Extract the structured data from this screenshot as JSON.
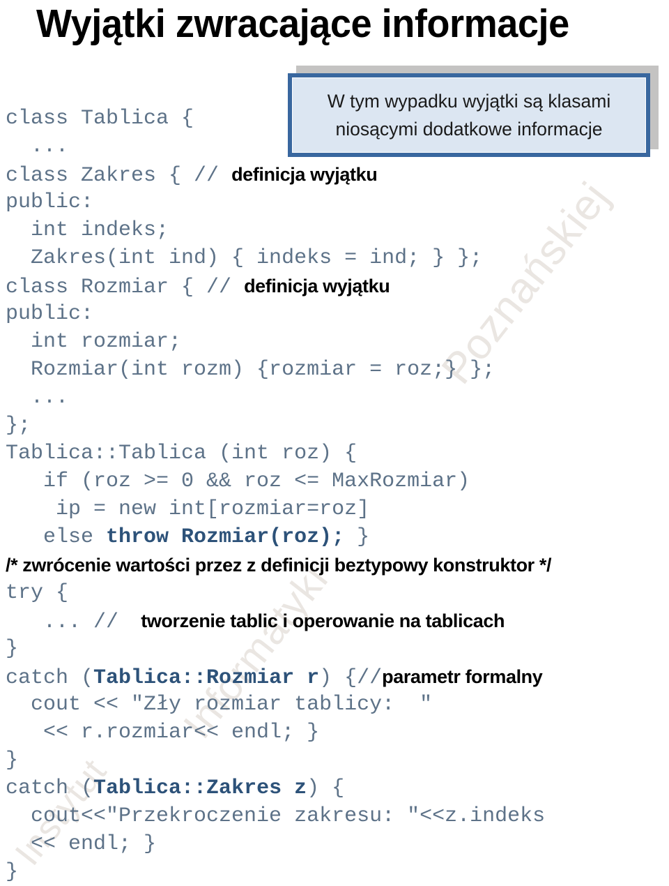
{
  "slide": {
    "title": "Wyjątki zwracające informacje",
    "background_color": "#ffffff"
  },
  "callout": {
    "lines": [
      "W tym wypadku wyjątki są klasami",
      "niosącymi dodatkowe informacje"
    ],
    "fill_color": "#dce6f2",
    "border_color": "#39679f",
    "shadow_color": "#c4c3c2"
  },
  "code": {
    "mono_color": "#5d7288",
    "mono_bold_color": "#2d5279",
    "comment_color": "#000000",
    "lines": [
      {
        "segments": [
          {
            "text": "class Tablica {",
            "style": "mono"
          }
        ]
      },
      {
        "segments": [
          {
            "text": "  ...",
            "style": "mono"
          }
        ]
      },
      {
        "segments": [
          {
            "text": "class Zakres { // ",
            "style": "mono"
          },
          {
            "text": "definicja wyjątku",
            "style": "comment"
          }
        ]
      },
      {
        "segments": [
          {
            "text": "public:",
            "style": "mono"
          }
        ]
      },
      {
        "segments": [
          {
            "text": "  int indeks;",
            "style": "mono"
          }
        ]
      },
      {
        "segments": [
          {
            "text": "  Zakres(int ind) { indeks = ind; } };",
            "style": "mono"
          }
        ]
      },
      {
        "segments": [
          {
            "text": "class Rozmiar { // ",
            "style": "mono"
          },
          {
            "text": "definicja wyjątku",
            "style": "comment"
          }
        ]
      },
      {
        "segments": [
          {
            "text": "public:",
            "style": "mono"
          }
        ]
      },
      {
        "segments": [
          {
            "text": "  int rozmiar;",
            "style": "mono"
          }
        ]
      },
      {
        "segments": [
          {
            "text": "  Rozmiar(int rozm) {rozmiar = roz;} };",
            "style": "mono"
          }
        ]
      },
      {
        "segments": [
          {
            "text": "  ...",
            "style": "mono"
          }
        ]
      },
      {
        "segments": [
          {
            "text": "};",
            "style": "mono"
          }
        ]
      },
      {
        "segments": [
          {
            "text": "Tablica::Tablica (int roz) {",
            "style": "mono"
          }
        ]
      },
      {
        "segments": [
          {
            "text": "   if (roz >= 0 && roz <= MaxRozmiar)",
            "style": "mono"
          }
        ]
      },
      {
        "segments": [
          {
            "text": "    ip = new int[rozmiar=roz]",
            "style": "mono"
          }
        ]
      },
      {
        "segments": [
          {
            "text": "   else ",
            "style": "mono"
          },
          {
            "text": "throw Rozmiar(roz);",
            "style": "mono-bold"
          },
          {
            "text": " }",
            "style": "mono"
          }
        ]
      },
      {
        "segments": [
          {
            "text": "/* zwrócenie wartości przez z definicji beztypowy konstruktor */",
            "style": "comment"
          }
        ]
      },
      {
        "segments": [
          {
            "text": "try {",
            "style": "mono"
          }
        ]
      },
      {
        "segments": [
          {
            "text": "   ... // ",
            "style": "mono"
          },
          {
            "text": "  tworzenie tablic i operowanie na tablicach",
            "style": "comment"
          }
        ]
      },
      {
        "segments": [
          {
            "text": "}",
            "style": "mono"
          }
        ]
      },
      {
        "segments": [
          {
            "text": "catch (",
            "style": "mono"
          },
          {
            "text": "Tablica::Rozmiar r",
            "style": "mono-bold"
          },
          {
            "text": ") {//",
            "style": "mono"
          },
          {
            "text": "parametr formalny",
            "style": "comment"
          }
        ]
      },
      {
        "segments": [
          {
            "text": "  cout << \"Zły rozmiar tablicy:  \"",
            "style": "mono"
          }
        ]
      },
      {
        "segments": [
          {
            "text": "   << r.rozmiar<< endl; }",
            "style": "mono"
          }
        ]
      },
      {
        "segments": [
          {
            "text": "}",
            "style": "mono"
          }
        ]
      },
      {
        "segments": [
          {
            "text": "catch (",
            "style": "mono"
          },
          {
            "text": "Tablica::Zakres z",
            "style": "mono-bold"
          },
          {
            "text": ") {",
            "style": "mono"
          }
        ]
      },
      {
        "segments": [
          {
            "text": "  cout<<\"Przekroczenie zakresu: \"<<z.indeks",
            "style": "mono"
          }
        ]
      },
      {
        "segments": [
          {
            "text": "  << endl; }",
            "style": "mono"
          }
        ]
      },
      {
        "segments": [
          {
            "text": "}",
            "style": "mono"
          }
        ]
      }
    ]
  },
  "watermark": {
    "lines": [
      "Poznańskiej",
      "Informatyki",
      "Instytut"
    ]
  }
}
